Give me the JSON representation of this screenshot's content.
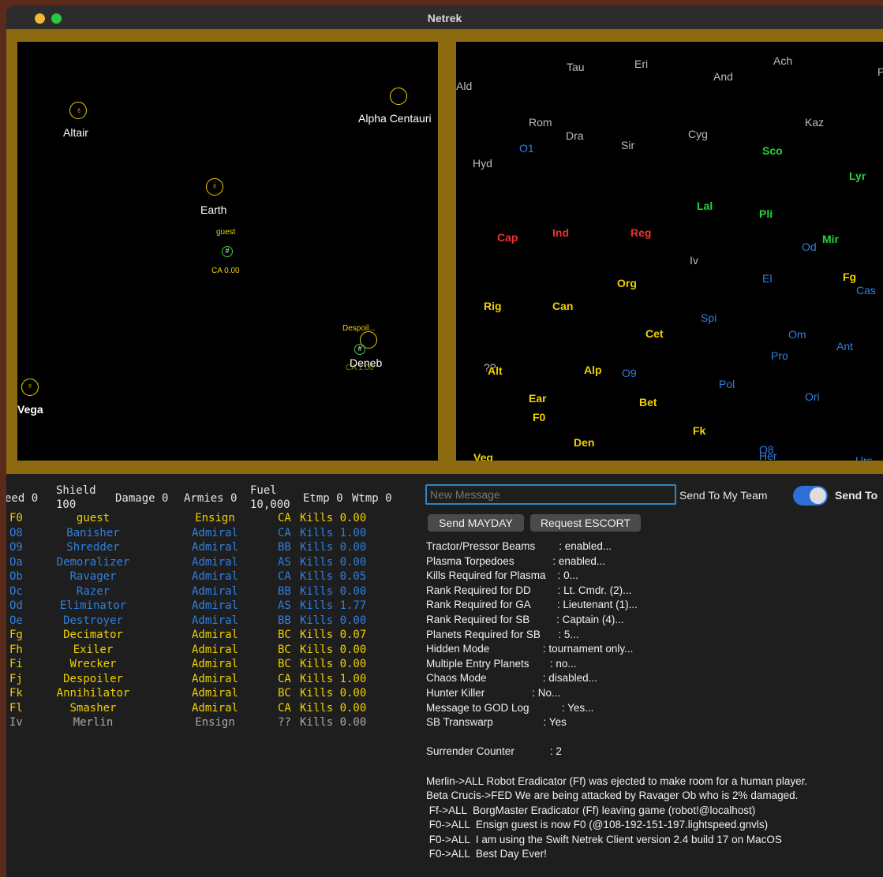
{
  "window": {
    "title": "Netrek"
  },
  "tactical": {
    "planets": [
      {
        "name": "Altair"
      },
      {
        "name": "Alpha Centauri"
      },
      {
        "name": "Earth"
      },
      {
        "name": "Deneb"
      },
      {
        "name": "Vega"
      }
    ],
    "ships": [
      {
        "name": "guest",
        "status": "CA 0.00"
      },
      {
        "name": "Despoil...",
        "status": "CA 1.00"
      }
    ]
  },
  "galactic": {
    "labels": [
      {
        "text": "Tau",
        "color": "#bdbdbd"
      },
      {
        "text": "Eri",
        "color": "#bdbdbd"
      },
      {
        "text": "And",
        "color": "#bdbdbd"
      },
      {
        "text": "Ach",
        "color": "#bdbdbd"
      },
      {
        "text": "Pra",
        "color": "#bdbdbd"
      },
      {
        "text": "Ald",
        "color": "#bdbdbd"
      },
      {
        "text": "Rom",
        "color": "#bdbdbd"
      },
      {
        "text": "Kaz",
        "color": "#bdbdbd"
      },
      {
        "text": "Dra",
        "color": "#bdbdbd"
      },
      {
        "text": "Cyg",
        "color": "#bdbdbd"
      },
      {
        "text": "O1",
        "color": "#2f80e0"
      },
      {
        "text": "Sir",
        "color": "#bdbdbd"
      },
      {
        "text": "Sco",
        "color": "#22d63a"
      },
      {
        "text": "Hyd",
        "color": "#bdbdbd"
      },
      {
        "text": "Lyr",
        "color": "#22d63a"
      },
      {
        "text": "Lal",
        "color": "#22d63a"
      },
      {
        "text": "Pli",
        "color": "#22d63a"
      },
      {
        "text": "Ind",
        "color": "#f03030"
      },
      {
        "text": "Reg",
        "color": "#f03030"
      },
      {
        "text": "Cap",
        "color": "#f03030"
      },
      {
        "text": "Mir",
        "color": "#22d63a"
      },
      {
        "text": "Od",
        "color": "#2f80e0"
      },
      {
        "text": "Iv",
        "color": "#bdbdbd"
      },
      {
        "text": "Fg",
        "color": "#f0d000"
      },
      {
        "text": "El",
        "color": "#2f80e0"
      },
      {
        "text": "Org",
        "color": "#f0d000"
      },
      {
        "text": "Cas",
        "color": "#2f80e0"
      },
      {
        "text": "Rig",
        "color": "#f0d000"
      },
      {
        "text": "Can",
        "color": "#f0d000"
      },
      {
        "text": "Spi",
        "color": "#2f80e0"
      },
      {
        "text": "Cet",
        "color": "#f0d000"
      },
      {
        "text": "Om",
        "color": "#2f80e0"
      },
      {
        "text": "Ant",
        "color": "#2f80e0"
      },
      {
        "text": "Pro",
        "color": "#2f80e0"
      },
      {
        "text": "??",
        "color": "#bdbdbd"
      },
      {
        "text": "Alt",
        "color": "#f0d000"
      },
      {
        "text": "Alp",
        "color": "#f0d000"
      },
      {
        "text": "O9",
        "color": "#2f80e0"
      },
      {
        "text": "Pol",
        "color": "#2f80e0"
      },
      {
        "text": "Ear",
        "color": "#f0d000"
      },
      {
        "text": "Bet",
        "color": "#f0d000"
      },
      {
        "text": "Ori",
        "color": "#2f80e0"
      },
      {
        "text": "F0",
        "color": "#f0d000"
      },
      {
        "text": "Fk",
        "color": "#f0d000"
      },
      {
        "text": "Den",
        "color": "#f0d000"
      },
      {
        "text": "Veg",
        "color": "#f0d000"
      },
      {
        "text": "O8",
        "color": "#2f80e0"
      },
      {
        "text": "Her",
        "color": "#2f80e0"
      },
      {
        "text": "Urs",
        "color": "#2f80e0"
      }
    ]
  },
  "stats": {
    "speed": "eed 0",
    "shield_label": "Shield",
    "shield_value": "100",
    "damage": "Damage 0",
    "armies": "Armies 0",
    "fuel_label": "Fuel",
    "fuel_value": "10,000",
    "etmp": "Etmp 0",
    "wtmp": "Wtmp 0"
  },
  "players": [
    {
      "id": "F0",
      "name": "guest",
      "rank": "Ensign",
      "ship": "CA",
      "kills": "Kills 0.00",
      "color": "#f0d000"
    },
    {
      "id": "O8",
      "name": "Banisher",
      "rank": "Admiral",
      "ship": "CA",
      "kills": "Kills 1.00",
      "color": "#2f80e0"
    },
    {
      "id": "O9",
      "name": "Shredder",
      "rank": "Admiral",
      "ship": "BB",
      "kills": "Kills 0.00",
      "color": "#2f80e0"
    },
    {
      "id": "Oa",
      "name": "Demoralizer",
      "rank": "Admiral",
      "ship": "AS",
      "kills": "Kills 0.00",
      "color": "#2f80e0"
    },
    {
      "id": "Ob",
      "name": "Ravager",
      "rank": "Admiral",
      "ship": "CA",
      "kills": "Kills 0.05",
      "color": "#2f80e0"
    },
    {
      "id": "Oc",
      "name": "Razer",
      "rank": "Admiral",
      "ship": "BB",
      "kills": "Kills 0.00",
      "color": "#2f80e0"
    },
    {
      "id": "Od",
      "name": "Eliminator",
      "rank": "Admiral",
      "ship": "AS",
      "kills": "Kills 1.77",
      "color": "#2f80e0"
    },
    {
      "id": "Oe",
      "name": "Destroyer",
      "rank": "Admiral",
      "ship": "BB",
      "kills": "Kills 0.00",
      "color": "#2f80e0"
    },
    {
      "id": "Fg",
      "name": "Decimator",
      "rank": "Admiral",
      "ship": "BC",
      "kills": "Kills 0.07",
      "color": "#f0d000"
    },
    {
      "id": "Fh",
      "name": "Exiler",
      "rank": "Admiral",
      "ship": "BC",
      "kills": "Kills 0.00",
      "color": "#f0d000"
    },
    {
      "id": "Fi",
      "name": "Wrecker",
      "rank": "Admiral",
      "ship": "BC",
      "kills": "Kills 0.00",
      "color": "#f0d000"
    },
    {
      "id": "Fj",
      "name": "Despoiler",
      "rank": "Admiral",
      "ship": "CA",
      "kills": "Kills 1.00",
      "color": "#f0d000"
    },
    {
      "id": "Fk",
      "name": "Annihilator",
      "rank": "Admiral",
      "ship": "BC",
      "kills": "Kills 0.00",
      "color": "#f0d000"
    },
    {
      "id": "Fl",
      "name": "Smasher",
      "rank": "Admiral",
      "ship": "CA",
      "kills": "Kills 0.00",
      "color": "#f0d000"
    },
    {
      "id": "Iv",
      "name": "Merlin",
      "rank": "Ensign",
      "ship": "??",
      "kills": "Kills 0.00",
      "color": "#a8a8a8"
    }
  ],
  "messaging": {
    "placeholder": "New Message",
    "send_team": "Send To My Team",
    "send_to": "Send To",
    "mayday": "Send MAYDAY",
    "escort": "Request ESCORT"
  },
  "info_lines": [
    "Tractor/Pressor Beams        : enabled...",
    "Plasma Torpedoes             : enabled...",
    "Kills Required for Plasma    : 0...",
    "Rank Required for DD         : Lt. Cmdr. (2)...",
    "Rank Required for GA         : Lieutenant (1)...",
    "Rank Required for SB         : Captain (4)...",
    "Planets Required for SB      : 5...",
    "Hidden Mode                  : tournament only...",
    "Multiple Entry Planets       : no...",
    "Chaos Mode                   : disabled...",
    "Hunter Killer                : No...",
    "Message to GOD Log           : Yes...",
    "SB Transwarp                 : Yes",
    "",
    "Surrender Counter            : 2",
    "",
    "Merlin->ALL Robot Eradicator (Ff) was ejected to make room for a human player.",
    "Beta Crucis->FED We are being attacked by Ravager Ob who is 2% damaged.",
    " Ff->ALL  BorgMaster Eradicator (Ff) leaving game (robot!@localhost)",
    " F0->ALL  Ensign guest is now F0 (@108-192-151-197.lightspeed.gnvls)",
    " F0->ALL  I am using the Swift Netrek Client version 2.4 build 17 on MacOS",
    " F0->ALL  Best Day Ever!"
  ]
}
